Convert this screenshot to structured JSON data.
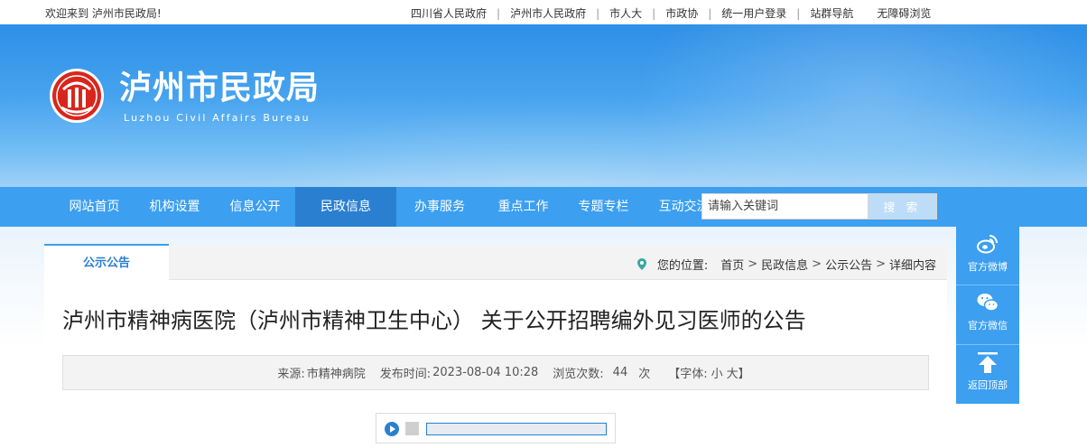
{
  "topbar": {
    "welcome": "欢迎来到 泸州市民政局!",
    "links": [
      "四川省人民政府",
      "泸州市人民政府",
      "市人大",
      "市政协",
      "统一用户登录",
      "站群导航",
      "无障碍浏览"
    ]
  },
  "header": {
    "title": "泸州市民政局",
    "subtitle": "Luzhou Civil Affairs Bureau",
    "logo_char": "民"
  },
  "nav": {
    "items": [
      "网站首页",
      "机构设置",
      "信息公开",
      "民政信息",
      "办事服务",
      "重点工作",
      "专题专栏",
      "互动交流"
    ],
    "active_index": 3
  },
  "search": {
    "placeholder": "请输入关键词",
    "button": "搜 索"
  },
  "tab": {
    "label": "公示公告"
  },
  "breadcrumb": {
    "label": "您的位置:",
    "items": [
      "首页",
      "民政信息",
      "公示公告",
      "详细内容"
    ]
  },
  "article": {
    "title": "泸州市精神病医院（泸州市精神卫生中心） 关于公开招聘编外见习医师的公告",
    "source_label": "来源:",
    "source": "市精神病院",
    "published_label": "发布时间:",
    "published": "2023-08-04 10:28",
    "views_label": "浏览次数:",
    "views": "44",
    "views_unit": "次",
    "font_label": "【字体:",
    "font_small": "小",
    "font_large": "大",
    "font_close": "】"
  },
  "side": {
    "weibo": "官方微博",
    "wechat": "官方微信",
    "top": "返回顶部"
  },
  "colors": {
    "nav_bg": "#3c9ff0",
    "nav_active": "#2a7fd0",
    "logo_red": "#d9261c"
  }
}
